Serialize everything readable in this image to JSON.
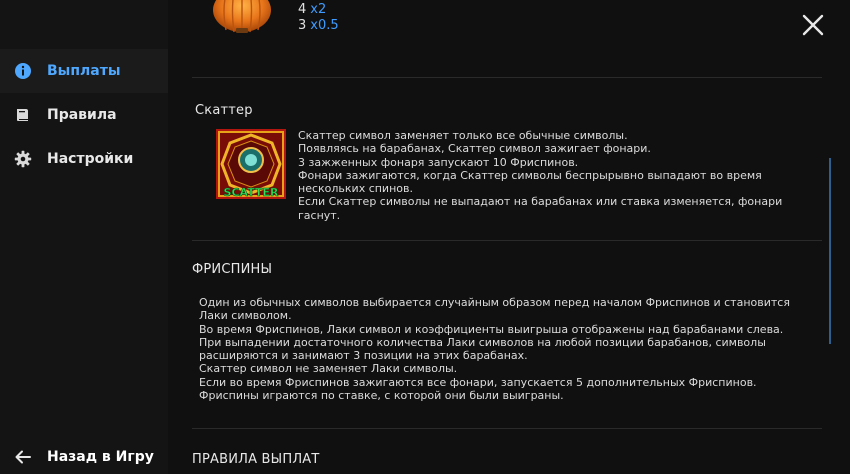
{
  "sidebar": {
    "items": [
      {
        "label": "Выплаты",
        "icon": "info-icon",
        "active": true
      },
      {
        "label": "Правила",
        "icon": "book-icon",
        "active": false
      },
      {
        "label": "Настройки",
        "icon": "gear-icon",
        "active": false
      }
    ],
    "back_label": "Назад в Игру"
  },
  "payouts": {
    "rows": [
      {
        "count": "4",
        "mult": "x2"
      },
      {
        "count": "3",
        "mult": "x0.5"
      }
    ]
  },
  "scatter": {
    "title": "Скаттер",
    "image_text": "SCATTER",
    "lines": [
      "Скаттер символ заменяет только все обычные символы.",
      "Появляясь на барабанах, Скаттер символ зажигает фонари.",
      "3 зажженных фонаря запускают 10 Фриспинов.",
      "Фонари зажигаются, когда Скаттер символы беспрырывно выпадают во время нескольких спинов.",
      "Если Скаттер символы не выпадают на барабанах или ставка изменяется, фонари гаснут."
    ]
  },
  "freespins": {
    "title": "ФРИСПИНЫ",
    "lines": [
      "Один из обычных символов выбирается случайным образом перед началом Фриспинов и становится Лаки символом.",
      "Во время Фриспинов, Лаки символ и коэффициенты выигрыша отображены над барабанами слева.",
      "При выпадении достаточного количества Лаки символов на любой позиции барабанов, символы расширяются и занимают 3 позиции на этих барабанах.",
      "Скаттер символ не заменяет Лаки символы.",
      "Если во время Фриспинов зажигаются все фонари, запускается 5 дополнительных Фриспинов.",
      "Фриспины играются по ставке, с которой они были выиграны."
    ]
  },
  "payrules": {
    "title": "ПРАВИЛА ВЫПЛАТ"
  },
  "colors": {
    "accent": "#4fa8ff",
    "multiplier": "#3f9cff",
    "background": "#101010",
    "sidebar": "#141414"
  }
}
